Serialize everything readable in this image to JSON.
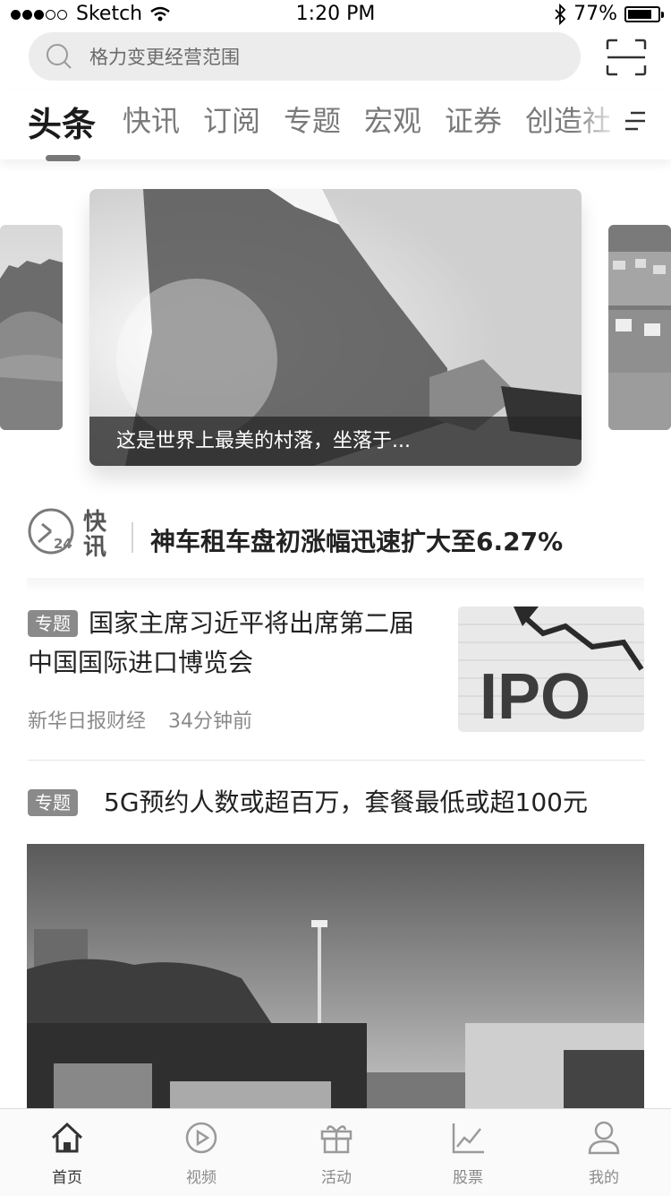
{
  "status_bar": {
    "carrier": "Sketch",
    "time": "1:20 PM",
    "battery": "77%"
  },
  "search": {
    "placeholder": "格力变更经营范围"
  },
  "tabs": [
    {
      "label": "头条",
      "active": true
    },
    {
      "label": "快讯"
    },
    {
      "label": "订阅"
    },
    {
      "label": "专题"
    },
    {
      "label": "宏观"
    },
    {
      "label": "证券"
    },
    {
      "label": "创造社"
    }
  ],
  "carousel": {
    "caption": "这是世界上最美的村落，坐落于..."
  },
  "flash": {
    "logo_text_1": "快",
    "logo_text_2": "讯",
    "clock_number": "24",
    "headline": "神车租车盘初涨幅迅速扩大至6.27%"
  },
  "articles": [
    {
      "badge": "专题",
      "title": "国家主席习近平将出席第二届中国国际进口博览会",
      "source": "新华日报财经",
      "time": "34分钟前",
      "image_text": "IPO"
    },
    {
      "badge": "专题",
      "title": "5G预约人数或超百万，套餐最低或超100元"
    }
  ],
  "bottom_nav": [
    {
      "label": "首页",
      "icon": "home-icon",
      "active": true
    },
    {
      "label": "视频",
      "icon": "video-icon"
    },
    {
      "label": "活动",
      "icon": "gift-icon"
    },
    {
      "label": "股票",
      "icon": "stock-chart-icon"
    },
    {
      "label": "我的",
      "icon": "profile-icon"
    }
  ]
}
